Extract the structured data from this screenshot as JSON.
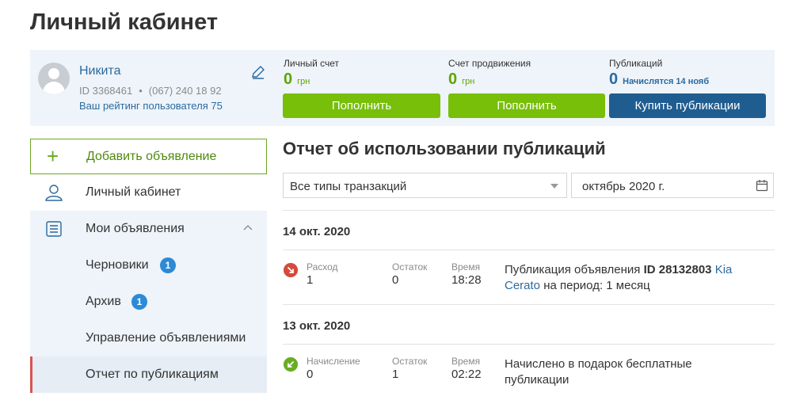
{
  "page": {
    "title": "Личный кабинет"
  },
  "profile": {
    "name": "Никита",
    "id_text": "ID 3368461",
    "separator": "•",
    "phone": "(067) 240 18 92",
    "rating": "Ваш рейтинг пользователя 75",
    "edit_icon": "pencil-icon"
  },
  "accounts": [
    {
      "label": "Личный счет",
      "value": "0",
      "currency": "грн",
      "button": "Пополнить"
    },
    {
      "label": "Счет продвижения",
      "value": "0",
      "currency": "грн",
      "button": "Пополнить"
    },
    {
      "label": "Публикаций",
      "value": "0",
      "note": "Начислятся 14 нояб",
      "button": "Купить публикации"
    }
  ],
  "sidebar": {
    "add_label": "Добавить объявление",
    "cabinet_label": "Личный кабинет",
    "my_ads_label": "Мои объявления",
    "sub_items": [
      {
        "label": "Черновики",
        "badge": "1"
      },
      {
        "label": "Архив",
        "badge": "1"
      },
      {
        "label": "Управление объявлениями"
      },
      {
        "label": "Отчет по публикациям"
      }
    ]
  },
  "report": {
    "title": "Отчет об использовании публикаций",
    "type_filter": "Все типы транзакций",
    "period": "октябрь  2020 г.",
    "days": [
      {
        "date": "14 окт. 2020",
        "tx": {
          "kind_label": "Расход",
          "kind_value": "1",
          "balance_label": "Остаток",
          "balance_value": "0",
          "time_label": "Время",
          "time_value": "18:28",
          "desc_prefix": "Публикация объявления ",
          "desc_id": "ID 28132803",
          "desc_link": "Kia Cerato",
          "desc_suffix": " на период: 1 месяц"
        }
      },
      {
        "date": "13 окт. 2020",
        "tx": {
          "kind_label": "Начисление",
          "kind_value": "0",
          "balance_label": "Остаток",
          "balance_value": "1",
          "time_label": "Время",
          "time_value": "02:22",
          "desc_text": "Начислено в подарок бесплатные публикации"
        }
      }
    ]
  },
  "colors": {
    "green": "#78bf09",
    "blue": "#1f5d91",
    "link": "#2c6a9e",
    "panel": "#eef4fa",
    "active_marker": "#d9534f"
  }
}
